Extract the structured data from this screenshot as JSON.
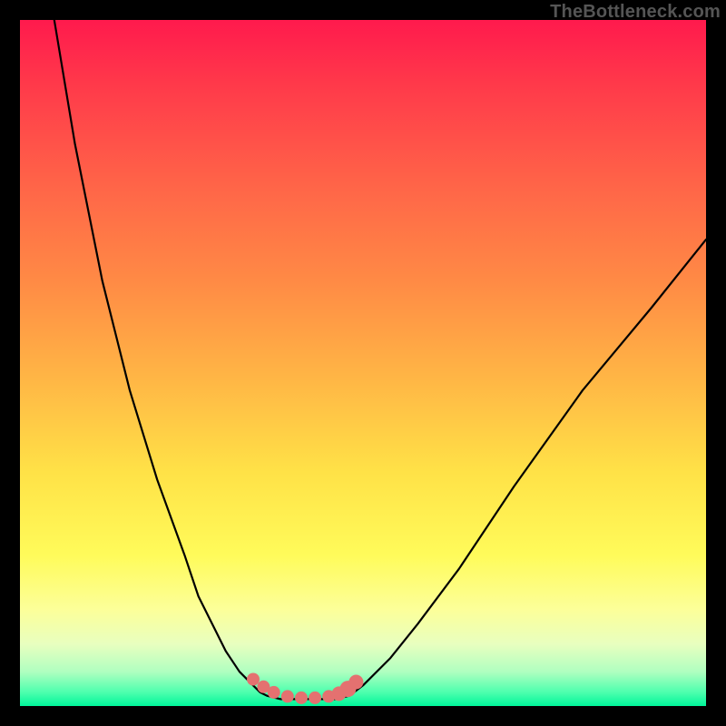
{
  "watermark": "TheBottleneck.com",
  "colors": {
    "background": "#000000",
    "gradient_top": "#ff1a4d",
    "gradient_bottom": "#00f59a",
    "curve": "#000000",
    "dots": "#e47170"
  },
  "chart_data": {
    "type": "line",
    "title": "",
    "xlabel": "",
    "ylabel": "",
    "xlim": [
      0,
      100
    ],
    "ylim": [
      0,
      100
    ],
    "series": [
      {
        "name": "left-branch",
        "x": [
          5,
          8,
          12,
          16,
          20,
          24,
          26,
          28,
          30,
          32,
          34,
          35,
          36
        ],
        "y": [
          100,
          82,
          62,
          46,
          33,
          22,
          16,
          12,
          8,
          5,
          3,
          2,
          1.5
        ]
      },
      {
        "name": "floor",
        "x": [
          36,
          38,
          40,
          42,
          44,
          46,
          48
        ],
        "y": [
          1.5,
          1,
          1,
          1,
          1,
          1,
          1.5
        ]
      },
      {
        "name": "right-branch",
        "x": [
          48,
          50,
          54,
          58,
          64,
          72,
          82,
          92,
          100
        ],
        "y": [
          1.5,
          3,
          7,
          12,
          20,
          32,
          46,
          58,
          68
        ]
      }
    ],
    "markers": {
      "name": "dots",
      "x": [
        34,
        35.5,
        37,
        39,
        41,
        43,
        45,
        46.5,
        47.8,
        49
      ],
      "y": [
        3.9,
        2.8,
        2.0,
        1.4,
        1.2,
        1.2,
        1.4,
        1.8,
        2.5,
        3.5
      ],
      "radius": [
        7,
        7,
        7,
        7,
        7,
        7,
        7,
        8,
        9,
        8
      ]
    }
  }
}
